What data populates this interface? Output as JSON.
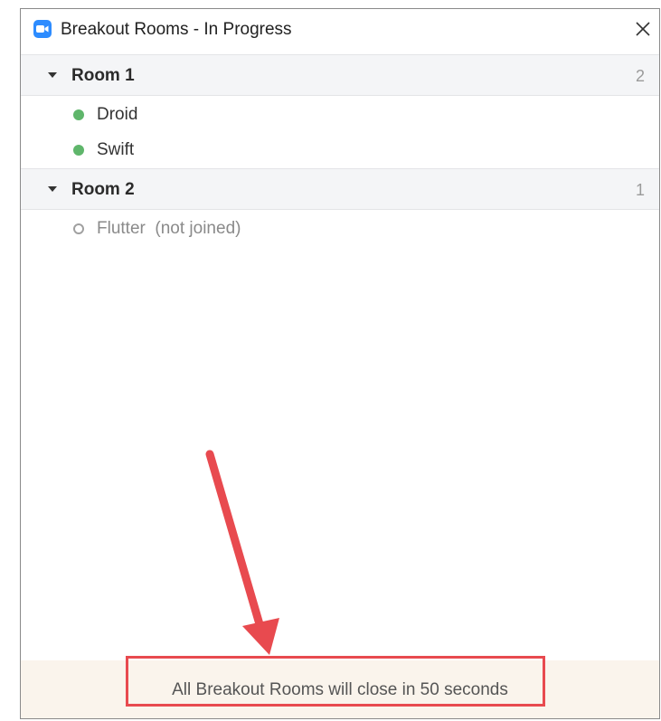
{
  "window": {
    "title": "Breakout Rooms - In Progress",
    "icon": "zoom-camera-icon",
    "close_icon": "close-icon"
  },
  "rooms": [
    {
      "name": "Room 1",
      "count": "2",
      "participants": [
        {
          "name": "Droid",
          "status": "joined"
        },
        {
          "name": "Swift",
          "status": "joined"
        }
      ]
    },
    {
      "name": "Room 2",
      "count": "1",
      "participants": [
        {
          "name": "Flutter  (not joined)",
          "status": "not-joined"
        }
      ]
    }
  ],
  "footer": {
    "message": "All Breakout Rooms will close in 50 seconds"
  },
  "colors": {
    "accent": "#2d8cff",
    "joined_dot": "#5fb66b",
    "annotation_red": "#e84a4f",
    "footer_bg": "#faf4ec",
    "header_bg": "#f4f5f7"
  }
}
